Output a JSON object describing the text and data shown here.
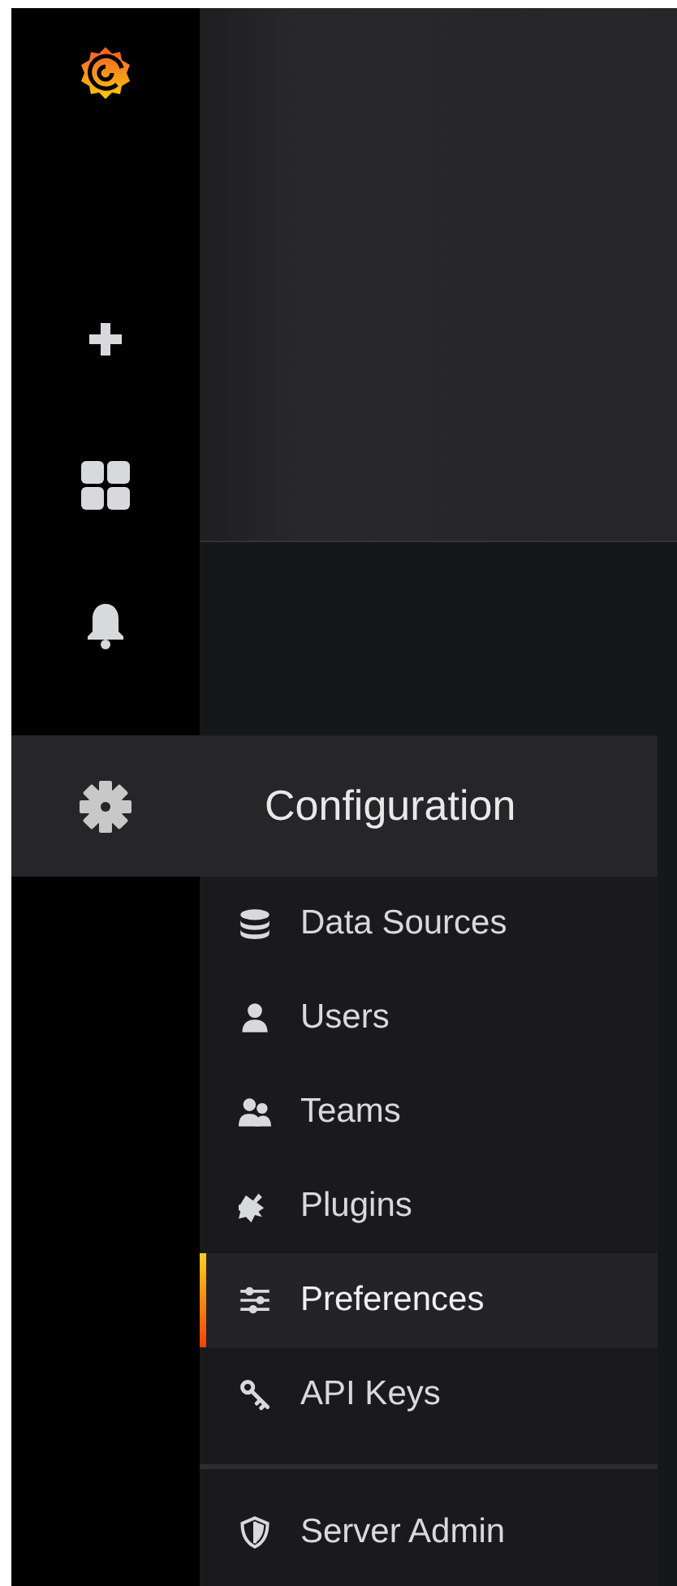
{
  "menu": {
    "title": "Configuration",
    "items": [
      {
        "label": "Data Sources",
        "selected": false
      },
      {
        "label": "Users",
        "selected": false
      },
      {
        "label": "Teams",
        "selected": false
      },
      {
        "label": "Plugins",
        "selected": false
      },
      {
        "label": "Preferences",
        "selected": true
      },
      {
        "label": "API Keys",
        "selected": false
      }
    ],
    "footer_items": [
      {
        "label": "Server Admin",
        "selected": false
      }
    ]
  }
}
